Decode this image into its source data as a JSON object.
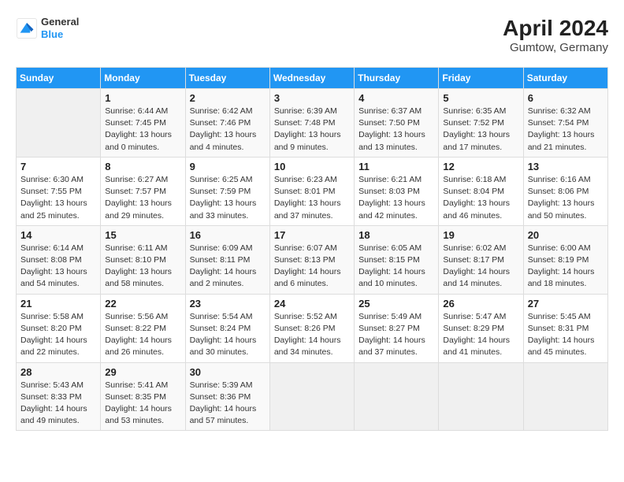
{
  "header": {
    "logo": {
      "line1": "General",
      "line2": "Blue"
    },
    "title": "April 2024",
    "subtitle": "Gumtow, Germany"
  },
  "weekdays": [
    "Sunday",
    "Monday",
    "Tuesday",
    "Wednesday",
    "Thursday",
    "Friday",
    "Saturday"
  ],
  "weeks": [
    [
      {
        "day": "",
        "info": ""
      },
      {
        "day": "1",
        "info": "Sunrise: 6:44 AM\nSunset: 7:45 PM\nDaylight: 13 hours and 0 minutes."
      },
      {
        "day": "2",
        "info": "Sunrise: 6:42 AM\nSunset: 7:46 PM\nDaylight: 13 hours and 4 minutes."
      },
      {
        "day": "3",
        "info": "Sunrise: 6:39 AM\nSunset: 7:48 PM\nDaylight: 13 hours and 9 minutes."
      },
      {
        "day": "4",
        "info": "Sunrise: 6:37 AM\nSunset: 7:50 PM\nDaylight: 13 hours and 13 minutes."
      },
      {
        "day": "5",
        "info": "Sunrise: 6:35 AM\nSunset: 7:52 PM\nDaylight: 13 hours and 17 minutes."
      },
      {
        "day": "6",
        "info": "Sunrise: 6:32 AM\nSunset: 7:54 PM\nDaylight: 13 hours and 21 minutes."
      }
    ],
    [
      {
        "day": "7",
        "info": "Sunrise: 6:30 AM\nSunset: 7:55 PM\nDaylight: 13 hours and 25 minutes."
      },
      {
        "day": "8",
        "info": "Sunrise: 6:27 AM\nSunset: 7:57 PM\nDaylight: 13 hours and 29 minutes."
      },
      {
        "day": "9",
        "info": "Sunrise: 6:25 AM\nSunset: 7:59 PM\nDaylight: 13 hours and 33 minutes."
      },
      {
        "day": "10",
        "info": "Sunrise: 6:23 AM\nSunset: 8:01 PM\nDaylight: 13 hours and 37 minutes."
      },
      {
        "day": "11",
        "info": "Sunrise: 6:21 AM\nSunset: 8:03 PM\nDaylight: 13 hours and 42 minutes."
      },
      {
        "day": "12",
        "info": "Sunrise: 6:18 AM\nSunset: 8:04 PM\nDaylight: 13 hours and 46 minutes."
      },
      {
        "day": "13",
        "info": "Sunrise: 6:16 AM\nSunset: 8:06 PM\nDaylight: 13 hours and 50 minutes."
      }
    ],
    [
      {
        "day": "14",
        "info": "Sunrise: 6:14 AM\nSunset: 8:08 PM\nDaylight: 13 hours and 54 minutes."
      },
      {
        "day": "15",
        "info": "Sunrise: 6:11 AM\nSunset: 8:10 PM\nDaylight: 13 hours and 58 minutes."
      },
      {
        "day": "16",
        "info": "Sunrise: 6:09 AM\nSunset: 8:11 PM\nDaylight: 14 hours and 2 minutes."
      },
      {
        "day": "17",
        "info": "Sunrise: 6:07 AM\nSunset: 8:13 PM\nDaylight: 14 hours and 6 minutes."
      },
      {
        "day": "18",
        "info": "Sunrise: 6:05 AM\nSunset: 8:15 PM\nDaylight: 14 hours and 10 minutes."
      },
      {
        "day": "19",
        "info": "Sunrise: 6:02 AM\nSunset: 8:17 PM\nDaylight: 14 hours and 14 minutes."
      },
      {
        "day": "20",
        "info": "Sunrise: 6:00 AM\nSunset: 8:19 PM\nDaylight: 14 hours and 18 minutes."
      }
    ],
    [
      {
        "day": "21",
        "info": "Sunrise: 5:58 AM\nSunset: 8:20 PM\nDaylight: 14 hours and 22 minutes."
      },
      {
        "day": "22",
        "info": "Sunrise: 5:56 AM\nSunset: 8:22 PM\nDaylight: 14 hours and 26 minutes."
      },
      {
        "day": "23",
        "info": "Sunrise: 5:54 AM\nSunset: 8:24 PM\nDaylight: 14 hours and 30 minutes."
      },
      {
        "day": "24",
        "info": "Sunrise: 5:52 AM\nSunset: 8:26 PM\nDaylight: 14 hours and 34 minutes."
      },
      {
        "day": "25",
        "info": "Sunrise: 5:49 AM\nSunset: 8:27 PM\nDaylight: 14 hours and 37 minutes."
      },
      {
        "day": "26",
        "info": "Sunrise: 5:47 AM\nSunset: 8:29 PM\nDaylight: 14 hours and 41 minutes."
      },
      {
        "day": "27",
        "info": "Sunrise: 5:45 AM\nSunset: 8:31 PM\nDaylight: 14 hours and 45 minutes."
      }
    ],
    [
      {
        "day": "28",
        "info": "Sunrise: 5:43 AM\nSunset: 8:33 PM\nDaylight: 14 hours and 49 minutes."
      },
      {
        "day": "29",
        "info": "Sunrise: 5:41 AM\nSunset: 8:35 PM\nDaylight: 14 hours and 53 minutes."
      },
      {
        "day": "30",
        "info": "Sunrise: 5:39 AM\nSunset: 8:36 PM\nDaylight: 14 hours and 57 minutes."
      },
      {
        "day": "",
        "info": ""
      },
      {
        "day": "",
        "info": ""
      },
      {
        "day": "",
        "info": ""
      },
      {
        "day": "",
        "info": ""
      }
    ]
  ]
}
